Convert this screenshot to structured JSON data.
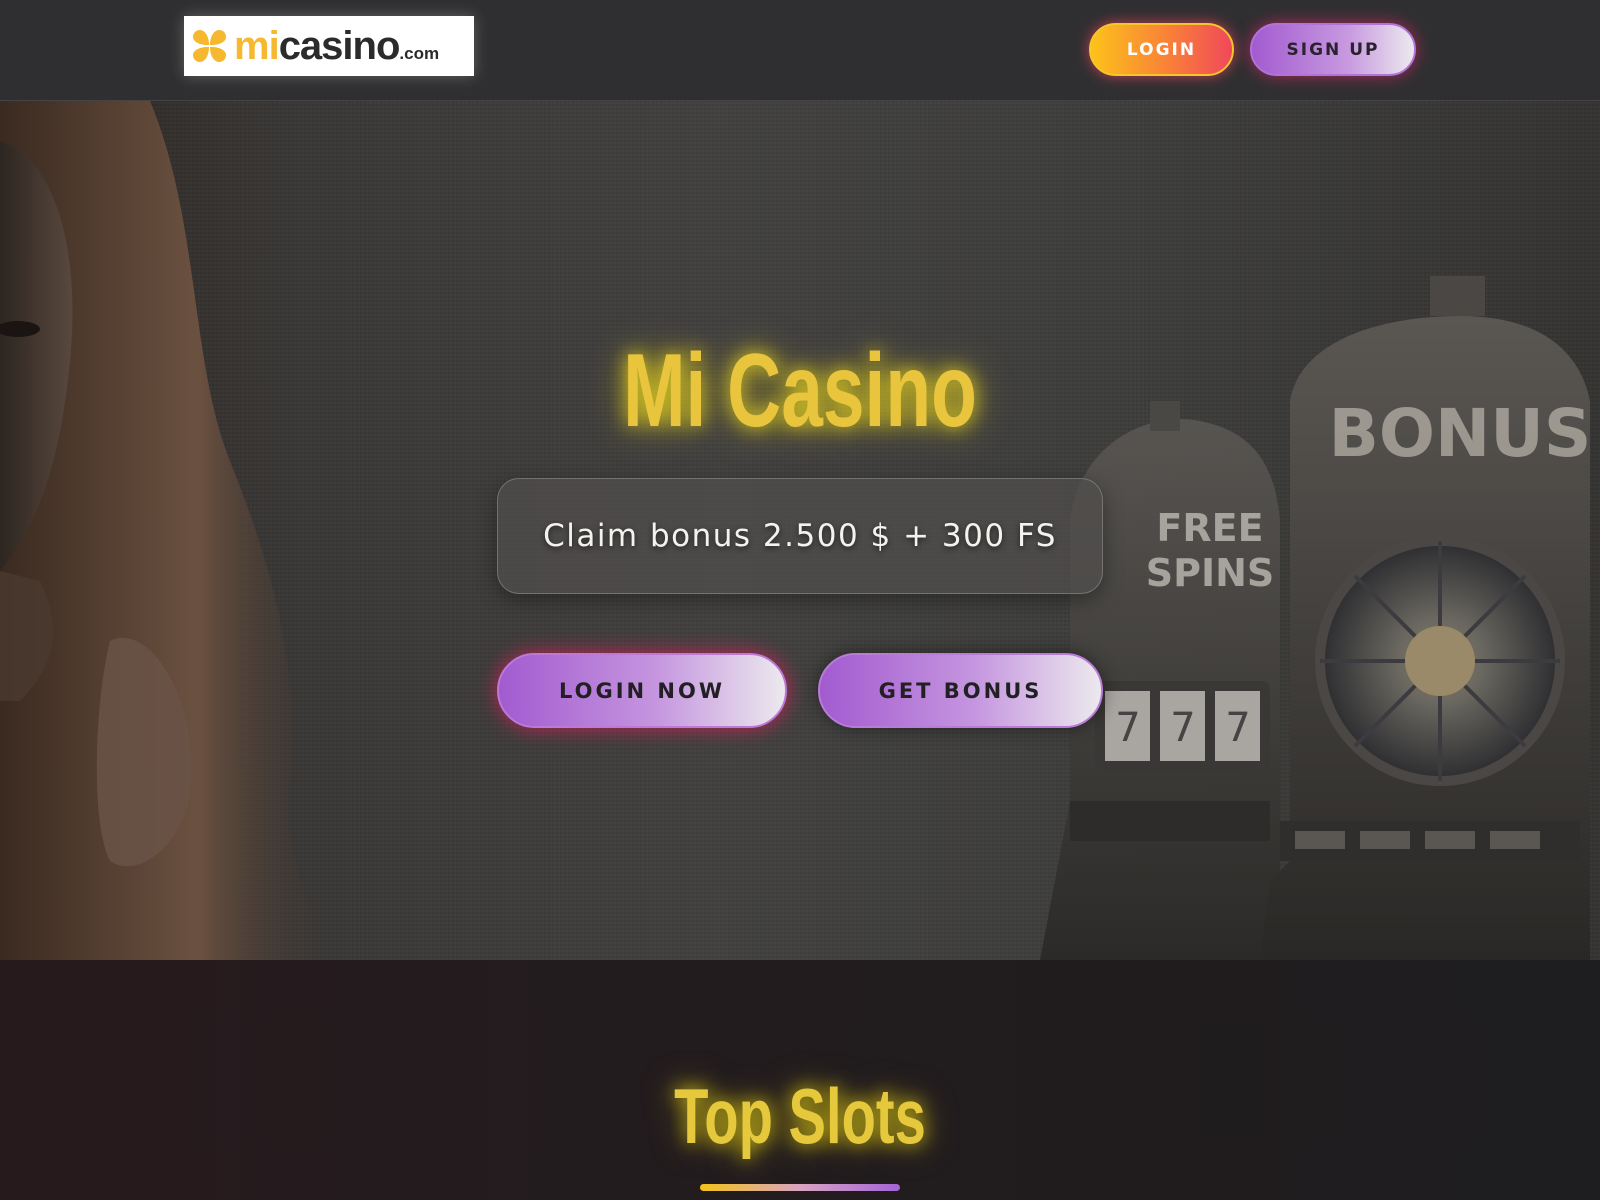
{
  "header": {
    "logo": {
      "text_mi": "mi",
      "text_casino": "casino",
      "text_dotcom": ".com",
      "icon": "clover-icon",
      "accent_color": "#f5b82e"
    },
    "login_label": "LOGIN",
    "signup_label": "SIGN UP"
  },
  "hero": {
    "title": "Mi Casino",
    "bonus_text": "Claim bonus 2.500 $ + 300 FS",
    "login_now_label": "LOGIN NOW",
    "get_bonus_label": "GET BONUS",
    "slot_machine_labels": [
      "FREE SPINS",
      "BONUS"
    ]
  },
  "top_slots": {
    "title": "Top Slots"
  },
  "colors": {
    "title_glow": "#e9c43d",
    "purple": "#a25bd0",
    "orange": "#f97a3c",
    "pink_glow": "#f0485a"
  }
}
